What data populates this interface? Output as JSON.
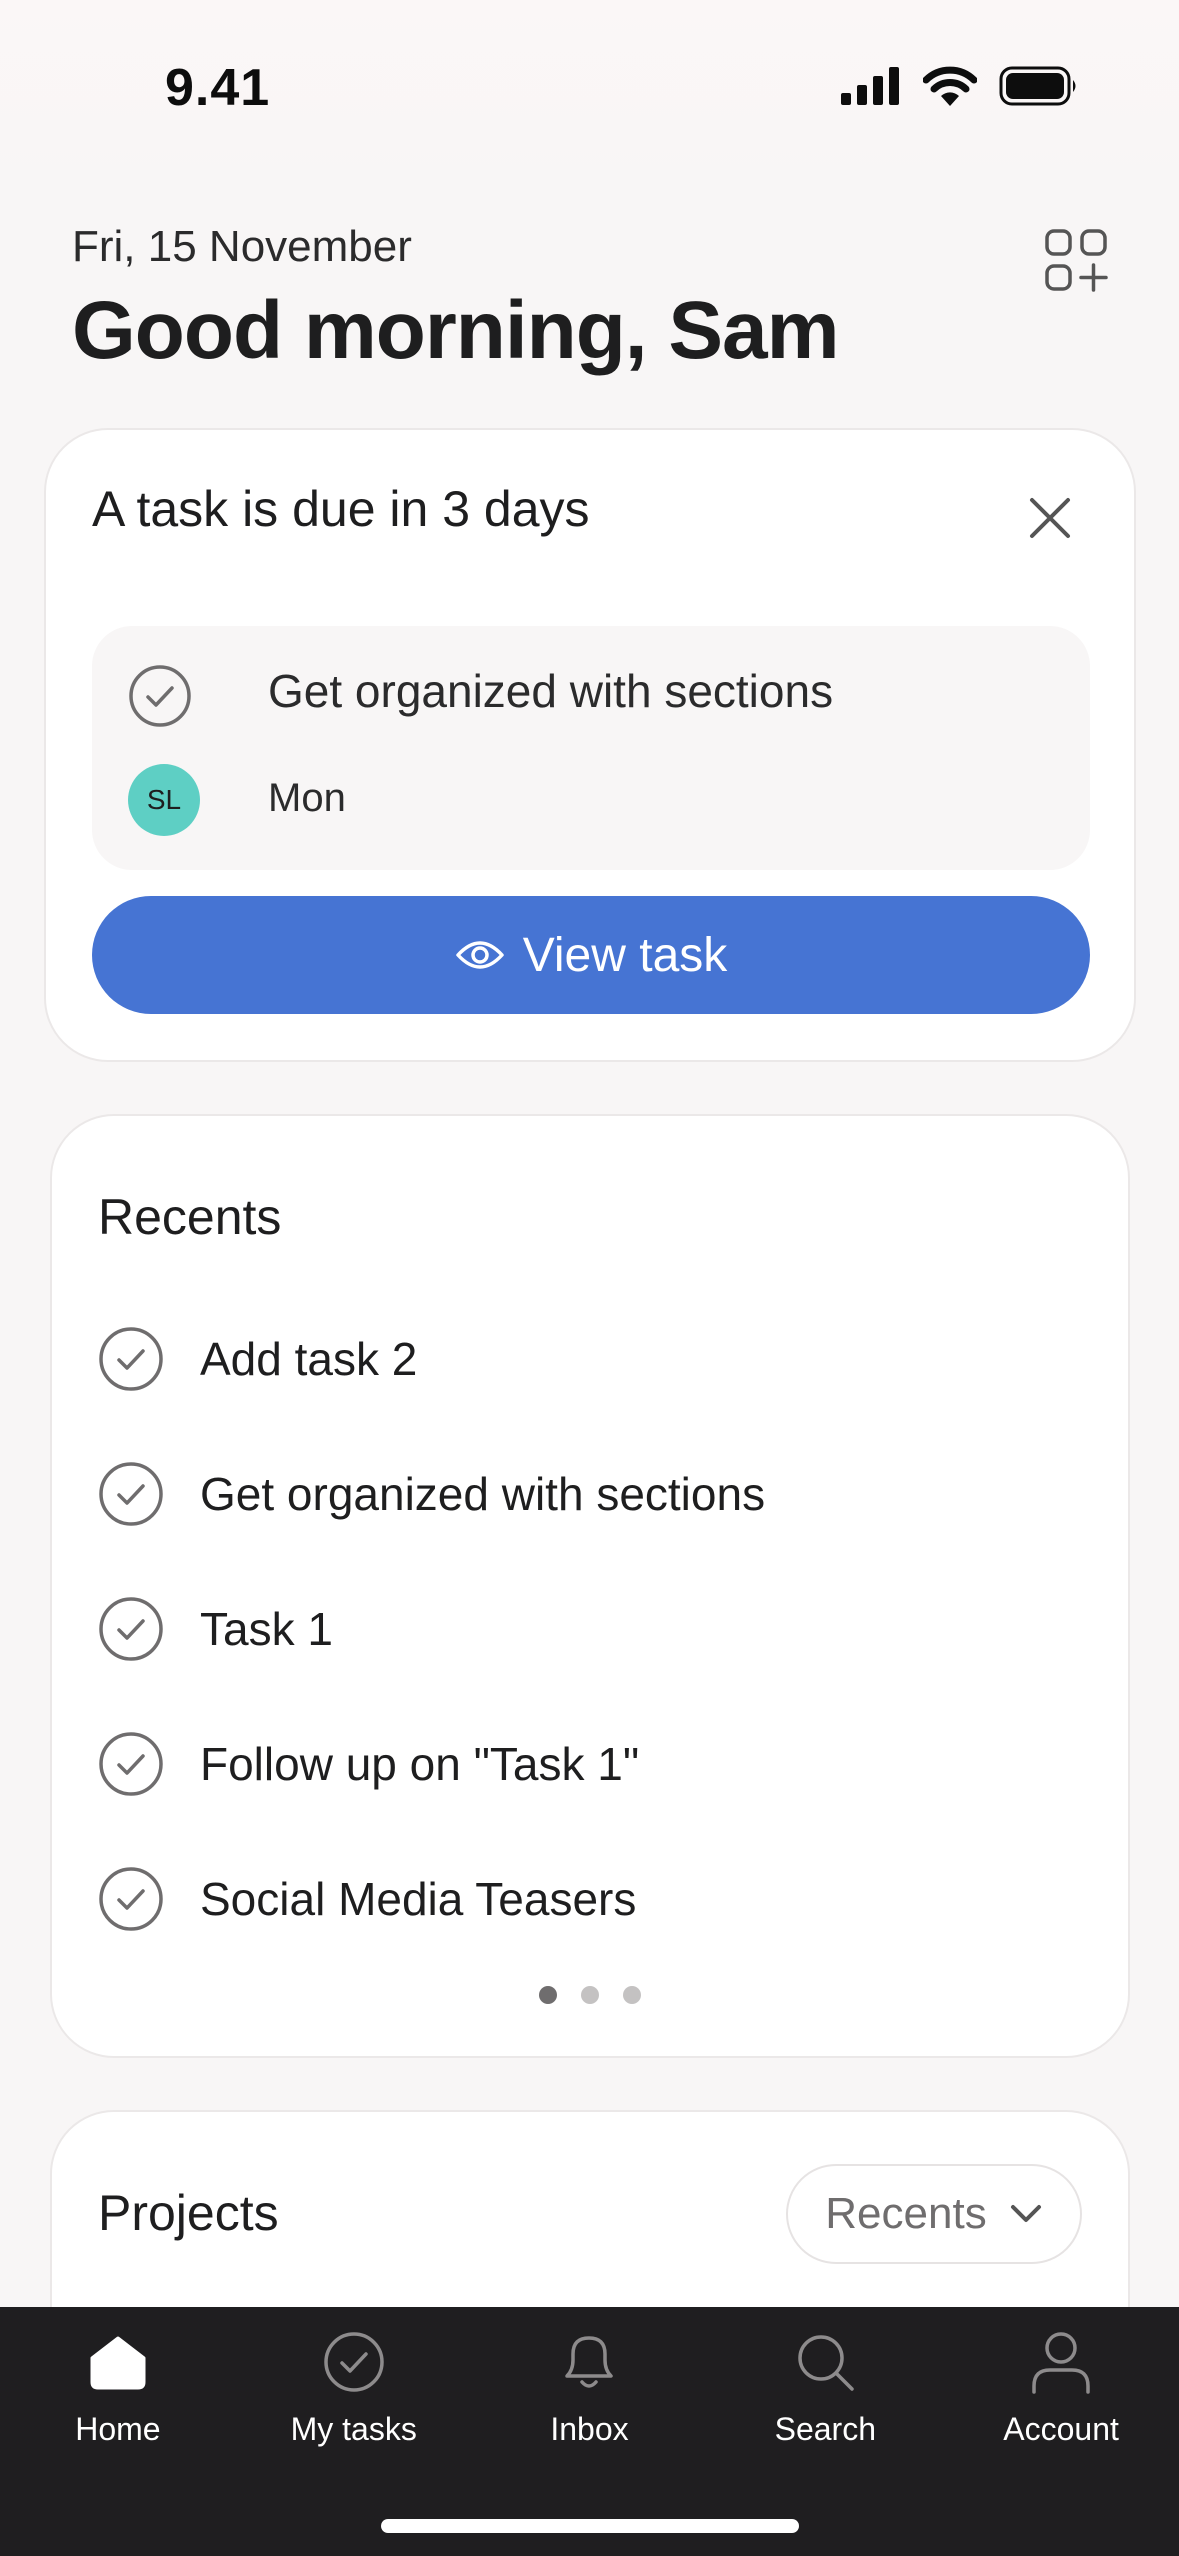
{
  "status_bar": {
    "time": "9.41"
  },
  "header": {
    "date": "Fri, 15 November",
    "greeting": "Good morning, Sam",
    "customize_icon": "grid-plus-icon"
  },
  "due_card": {
    "title": "A task is due in 3 days",
    "task_name": "Get organized with sections",
    "assignee_initials": "SL",
    "due_day": "Mon",
    "view_button_label": "View task"
  },
  "recents": {
    "title": "Recents",
    "items": [
      {
        "label": "Add task 2"
      },
      {
        "label": "Get organized with sections"
      },
      {
        "label": "Task 1"
      },
      {
        "label": "Follow up on \"Task 1\""
      },
      {
        "label": "Social Media Teasers"
      }
    ],
    "pages": 3,
    "active_page": 1
  },
  "projects": {
    "title": "Projects",
    "sort_value": "Recents"
  },
  "tab_bar": {
    "tabs": [
      {
        "label": "Home",
        "icon": "home-icon",
        "active": true
      },
      {
        "label": "My tasks",
        "icon": "check-circle-icon",
        "active": false
      },
      {
        "label": "Inbox",
        "icon": "bell-icon",
        "active": false
      },
      {
        "label": "Search",
        "icon": "search-icon",
        "active": false
      },
      {
        "label": "Account",
        "icon": "person-icon",
        "active": false
      }
    ]
  },
  "colors": {
    "accent": "#4674d3",
    "avatar": "#5ecfc4",
    "tab_bar": "#1f1e20"
  }
}
